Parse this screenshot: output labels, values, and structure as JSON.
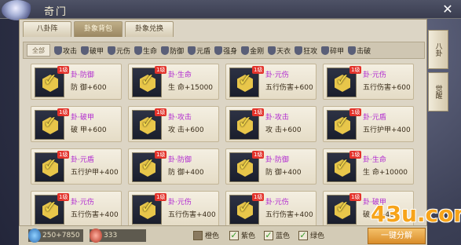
{
  "title": "奇门",
  "tabs": [
    {
      "label": "八卦阵"
    },
    {
      "label": "卦象背包"
    },
    {
      "label": "卦象兑换"
    }
  ],
  "filter": {
    "all": "全部",
    "items": [
      "攻击",
      "破甲",
      "元伤",
      "生命",
      "防御",
      "元盾",
      "强身",
      "金刚",
      "天衣",
      "狂攻",
      "碎甲",
      "击破"
    ]
  },
  "cards": [
    {
      "level": "1级",
      "name": "卦·防御",
      "stat": "防    御+600"
    },
    {
      "level": "1级",
      "name": "卦·生命",
      "stat": "生    命+15000"
    },
    {
      "level": "1级",
      "name": "卦·元伤",
      "stat": "五行伤害+600"
    },
    {
      "level": "1级",
      "name": "卦·元伤",
      "stat": "五行伤害+600"
    },
    {
      "level": "1级",
      "name": "卦·破甲",
      "stat": "破    甲+600"
    },
    {
      "level": "1级",
      "name": "卦·攻击",
      "stat": "攻    击+600"
    },
    {
      "level": "1级",
      "name": "卦·攻击",
      "stat": "攻    击+600"
    },
    {
      "level": "1级",
      "name": "卦·元盾",
      "stat": "五行护甲+400"
    },
    {
      "level": "1级",
      "name": "卦·元盾",
      "stat": "五行护甲+400"
    },
    {
      "level": "1级",
      "name": "卦·防御",
      "stat": "防    御+400"
    },
    {
      "level": "1级",
      "name": "卦·防御",
      "stat": "防    御+400"
    },
    {
      "level": "1级",
      "name": "卦·生命",
      "stat": "生    命+10000"
    },
    {
      "level": "1级",
      "name": "卦·元伤",
      "stat": "五行伤害+400"
    },
    {
      "level": "1级",
      "name": "卦·元伤",
      "stat": "五行伤害+400"
    },
    {
      "level": "1级",
      "name": "卦·元伤",
      "stat": "五行伤害+400"
    },
    {
      "level": "1级",
      "name": "卦·破甲",
      "stat": "破    甲+400"
    }
  ],
  "side": [
    {
      "label": "八卦"
    },
    {
      "label": "觉醒"
    }
  ],
  "resources": [
    {
      "value": "250+7850"
    },
    {
      "value": "333"
    }
  ],
  "quality": [
    {
      "label": "橙色",
      "checked": false
    },
    {
      "label": "紫色",
      "checked": true
    },
    {
      "label": "蓝色",
      "checked": true
    },
    {
      "label": "绿色",
      "checked": true
    }
  ],
  "button": "一键分解",
  "watermark": "43u.com"
}
